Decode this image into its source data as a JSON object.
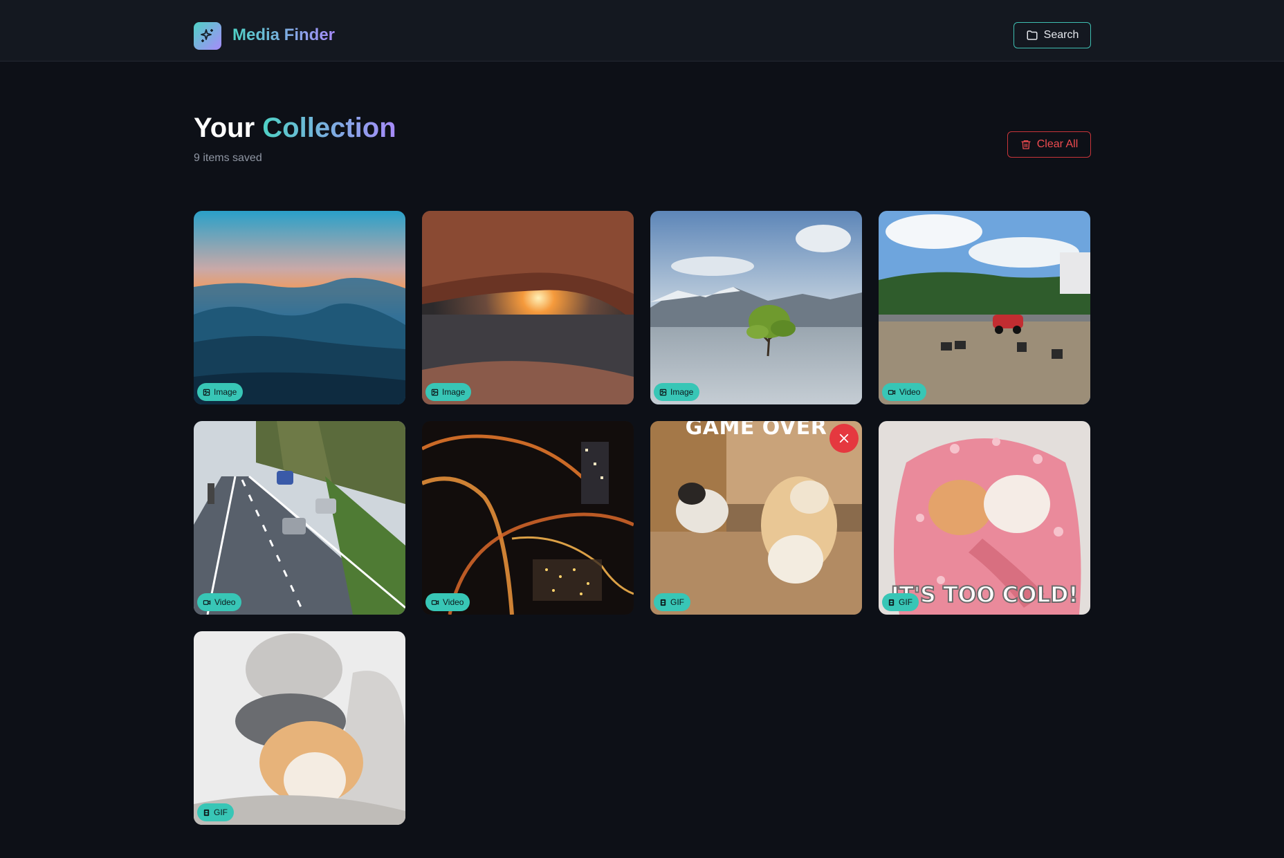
{
  "app": {
    "title": "Media Finder",
    "logo_icon": "sparkles-icon"
  },
  "header": {
    "search_label": "Search",
    "search_icon": "folder-icon"
  },
  "page": {
    "title_part1": "Your",
    "title_part2": "Collection",
    "subtitle": "9 items saved",
    "clear_label": "Clear All",
    "clear_icon": "trash-icon"
  },
  "colors": {
    "background": "#0d1017",
    "header_bg": "#141820",
    "accent_teal": "#4fd1c5",
    "accent_violet": "#a78bfa",
    "danger": "#ef4b50",
    "badge_bg": "#38c6b6"
  },
  "items": [
    {
      "type": "Image",
      "icon": "image-icon",
      "scene": "mountain sunset mist"
    },
    {
      "type": "Image",
      "icon": "image-icon",
      "scene": "rock arch sunrise canyon"
    },
    {
      "type": "Image",
      "icon": "image-icon",
      "scene": "lone tree in lake"
    },
    {
      "type": "Video",
      "icon": "video-icon",
      "scene": "rally car on track"
    },
    {
      "type": "Video",
      "icon": "video-icon",
      "scene": "highway traffic"
    },
    {
      "type": "Video",
      "icon": "video-icon",
      "scene": "aerial city night"
    },
    {
      "type": "GIF",
      "icon": "film-icon",
      "scene": "cats fighting",
      "overlay_text": "GAME OVER",
      "show_remove": true
    },
    {
      "type": "GIF",
      "icon": "film-icon",
      "scene": "cats in pink blanket",
      "overlay_text": "IT'S TOO COLD!"
    },
    {
      "type": "GIF",
      "icon": "film-icon",
      "scene": "stacked cats"
    }
  ]
}
